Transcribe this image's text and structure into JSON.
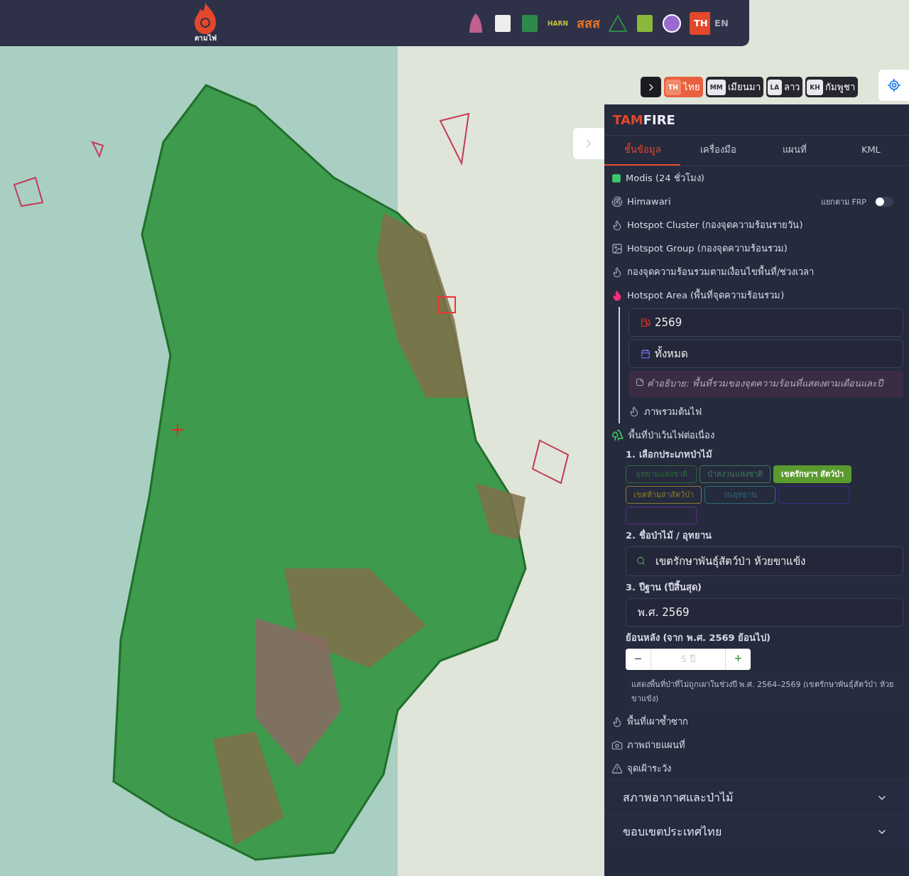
{
  "top_bar": {
    "logo_caption": "ตามไฟ",
    "partners": [
      {
        "kind": "seal"
      },
      {
        "kind": "book"
      },
      {
        "kind": "leaf"
      },
      {
        "kind": "harn",
        "label": "HARN"
      },
      {
        "kind": "sss",
        "label": "สสส"
      },
      {
        "kind": "mountain"
      },
      {
        "kind": "badge"
      },
      {
        "kind": "circle"
      }
    ],
    "languages": [
      {
        "label": "TH",
        "selected": true
      },
      {
        "label": "EN",
        "selected": false
      }
    ]
  },
  "map_languages": [
    {
      "code": "TH",
      "name": "ไทย",
      "selected": true
    },
    {
      "code": "MM",
      "name": "เมียนมา",
      "selected": false
    },
    {
      "code": "LA",
      "name": "ลาว",
      "selected": false
    },
    {
      "code": "KH",
      "name": "กัมพูชา",
      "selected": false
    }
  ],
  "sidebar": {
    "brand_accent": "TAM",
    "brand_rest": "FIRE",
    "tabs": [
      {
        "label": "ชั้นข้อมูล",
        "selected": true
      },
      {
        "label": "เครื่องมือ",
        "selected": false
      },
      {
        "label": "แผนที่",
        "selected": false
      },
      {
        "label": "KML",
        "selected": false
      }
    ],
    "layers": [
      {
        "kind": "plain",
        "label": "Modis (24 ชั่วโมง)"
      },
      {
        "kind": "toggle",
        "label": "Himawari",
        "toggle_label": "แยกตาม FRP",
        "on": false
      },
      {
        "kind": "plain",
        "label": "Hotspot Cluster (กองจุดความร้อนรายวัน)"
      },
      {
        "kind": "plain",
        "label": "Hotspot Group (กองจุดความร้อนรวม)"
      },
      {
        "kind": "plain",
        "label": "กองจุดความร้อนรวมตามเงื่อนไขพื้นที่/ช่วงเวลา"
      },
      {
        "kind": "expanded",
        "label": "Hotspot Area (พื้นที่จุดความร้อนรวม)",
        "year": "2569",
        "period": "ทั้งหมด",
        "note": "คำอธิบาย: พื้นที่รวมของจุดความร้อนที่แสดงตามเดือนและปี",
        "sub_item": "ภาพรวมต้นไฟ"
      }
    ],
    "forest": {
      "title": "พื้นที่ป่าเว้นไฟต่อเนื่อง",
      "step1": "1. เลือกประเภทป่าไม้",
      "chips": [
        {
          "label": "อุทยานแห่งชาติ",
          "color": "#2e6b3a",
          "selected": false
        },
        {
          "label": "ป่าสงวนแห่งชาติ",
          "color": "#3f7a5a",
          "selected": false
        },
        {
          "label": "เขตรักษาฯ สัตว์ป่า",
          "color": "#5a9a2e",
          "selected": true
        },
        {
          "label": "เขตห้ามล่าสัตว์ป่า",
          "color": "#8a7a2e",
          "selected": false
        },
        {
          "label": "วนอุทยาน",
          "color": "#2e6a7a",
          "selected": false
        },
        {
          "color": "#3a2e8a",
          "selected": false
        },
        {
          "color": "#5a2e8a",
          "selected": false
        }
      ],
      "step2": "2. ชื่อป่าไม้ / อุทยาน",
      "search_value": "เขตรักษาพันธุ์สัตว์ป่า ห้วยขาแข้ง",
      "step3": "3. ปีฐาน (ปีสิ้นสุด)",
      "base_year": "พ.ศ. 2569",
      "back_label": "ย้อนหลัง (จาก พ.ศ. 2569 ย้อนไป)",
      "minus": "−",
      "years_placeholder": "5 ปี",
      "plus": "+",
      "info": "แสดงพื้นที่ป่าที่ไม่ถูกเผาในช่วงปี พ.ศ. 2564–2569 (เขตรักษาพันธุ์สัตว์ป่า ห้วยขาแข้ง)"
    },
    "tail_items": [
      {
        "label": "พื้นที่เผาซ้ำซาก"
      },
      {
        "label": "ภาพถ่ายแผนที่"
      },
      {
        "label": "จุดเฝ้าระวัง"
      }
    ],
    "sections": [
      {
        "label": "สภาพอากาศและป่าไม้",
        "expanded": false
      },
      {
        "label": "ขอบเขตประเทศไทย",
        "expanded": false
      }
    ]
  }
}
